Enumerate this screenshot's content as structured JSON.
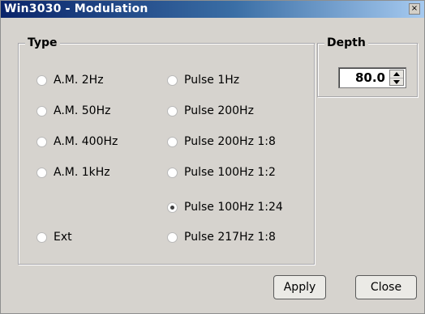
{
  "window": {
    "title": "Win3030 - Modulation",
    "close_glyph": "×"
  },
  "type_group": {
    "label": "Type",
    "options_left": [
      {
        "label": "A.M. 2Hz",
        "checked": false
      },
      {
        "label": "A.M. 50Hz",
        "checked": false
      },
      {
        "label": "A.M. 400Hz",
        "checked": false
      },
      {
        "label": "A.M. 1kHz",
        "checked": false
      },
      {
        "label": "Ext",
        "checked": false
      }
    ],
    "options_right": [
      {
        "label": "Pulse 1Hz",
        "checked": false
      },
      {
        "label": "Pulse 200Hz",
        "checked": false
      },
      {
        "label": "Pulse 200Hz 1:8",
        "checked": false
      },
      {
        "label": "Pulse 100Hz 1:2",
        "checked": false
      },
      {
        "label": "Pulse 100Hz 1:24",
        "checked": true
      },
      {
        "label": "Pulse 217Hz 1:8",
        "checked": false
      }
    ]
  },
  "depth_group": {
    "label": "Depth",
    "value": "80.0"
  },
  "buttons": {
    "apply": "Apply",
    "close": "Close"
  },
  "colors": {
    "face": "#d6d3ce",
    "title_start": "#0a246a",
    "title_end": "#a6caf0"
  }
}
